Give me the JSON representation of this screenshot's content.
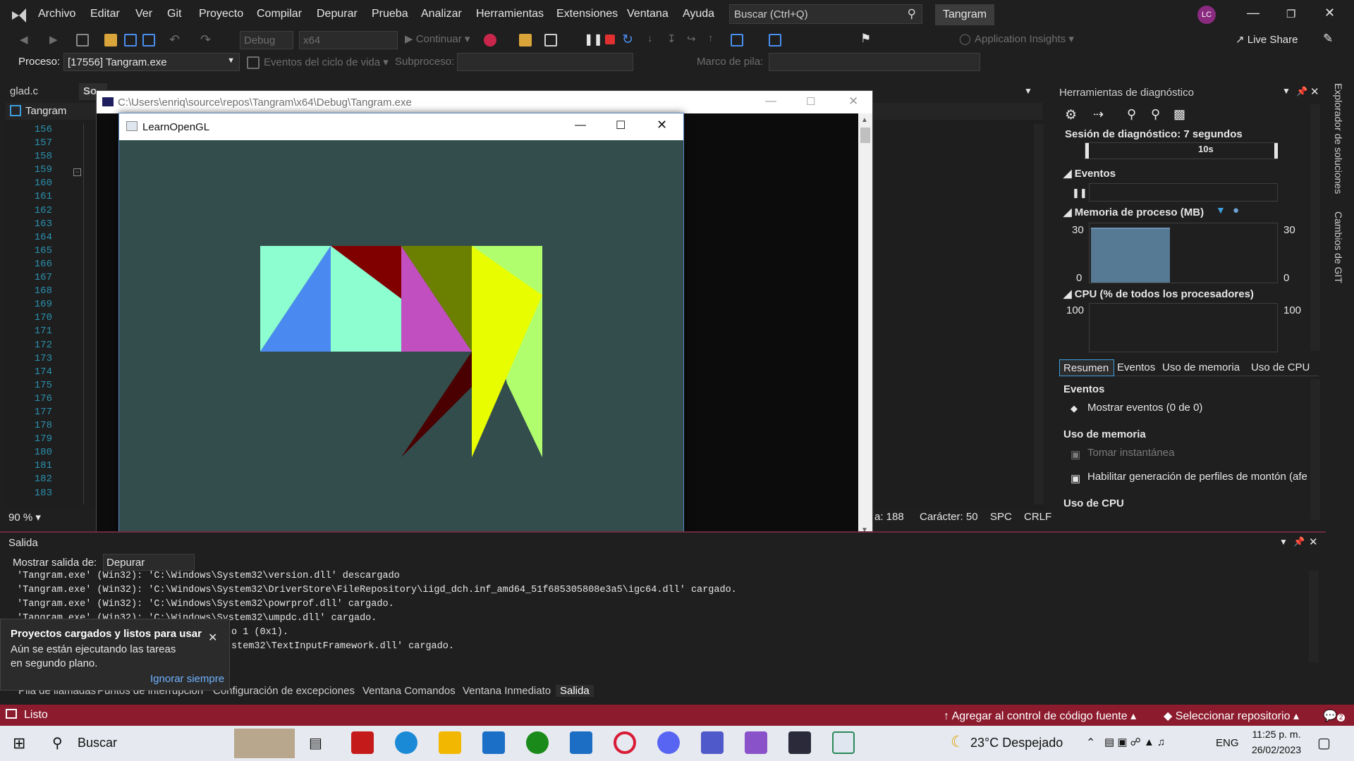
{
  "menu": [
    "Archivo",
    "Editar",
    "Ver",
    "Git",
    "Proyecto",
    "Compilar",
    "Depurar",
    "Prueba",
    "Analizar",
    "Herramientas",
    "Extensiones",
    "Ventana",
    "Ayuda"
  ],
  "search": {
    "placeholder": "Buscar (Ctrl+Q)"
  },
  "solution_name": "Tangram",
  "avatar_initials": "LC",
  "toolbar": {
    "config": "Debug",
    "platform": "x64",
    "continue": "Continuar",
    "app_insights": "Application Insights",
    "live_share": "Live Share"
  },
  "toolbar2": {
    "process_label": "Proceso:",
    "process_value": "[17556] Tangram.exe",
    "lifecycle": "Eventos del ciclo de vida",
    "thread_label": "Subproceso:",
    "stack_label": "Marco de pila:"
  },
  "doc_tabs": [
    "glad.c",
    "So"
  ],
  "nav_project": "Tangram",
  "line_numbers": [
    "156",
    "157",
    "158",
    "159",
    "160",
    "161",
    "162",
    "163",
    "164",
    "165",
    "166",
    "167",
    "168",
    "169",
    "170",
    "171",
    "172",
    "173",
    "174",
    "175",
    "176",
    "177",
    "178",
    "179",
    "180",
    "181",
    "182",
    "183"
  ],
  "editor_status": {
    "zoom": "90 %",
    "line": "a: 188",
    "char": "Carácter: 50",
    "spc": "SPC",
    "crlf": "CRLF"
  },
  "console": {
    "title": "C:\\Users\\enriq\\source\\repos\\Tangram\\x64\\Debug\\Tangram.exe"
  },
  "gl_window": {
    "title": "LearnOpenGL",
    "bg_color": "#334c4c"
  },
  "tangram_colors": {
    "mint": "#8cfecf",
    "blue": "#4a8af0",
    "darkred": "#800000",
    "magenta": "#c14fc0",
    "olive": "#6b7f00",
    "yellow": "#e8fe00",
    "lightgreen": "#b0fe6e",
    "maroon": "#4a0000"
  },
  "diag": {
    "title": "Herramientas de diagnóstico",
    "session": "Sesión de diagnóstico: 7 segundos",
    "time_marker": "10s",
    "events_label": "Eventos",
    "memory_label": "Memoria de proceso (MB)",
    "mem_max": "30",
    "mem_min": "0",
    "mem_usage_fraction": 0.93,
    "cpu_label": "CPU (% de todos los procesadores)",
    "cpu_max": "100",
    "tabs": [
      "Resumen",
      "Eventos",
      "Uso de memoria",
      "Uso de CPU"
    ],
    "sec_events": "Eventos",
    "show_events": "Mostrar eventos (0 de 0)",
    "sec_memory": "Uso de memoria",
    "snapshot": "Tomar instantánea",
    "heap_profiling": "Habilitar generación de perfiles de montón (afe",
    "sec_cpu": "Uso de CPU"
  },
  "side_tabs": [
    "Explorador de soluciones",
    "Cambios de GIT"
  ],
  "output": {
    "title": "Salida",
    "show_label": "Mostrar salida de:",
    "show_value": "Depurar",
    "lines": [
      "'Tangram.exe' (Win32): 'C:\\Windows\\System32\\version.dll' descargado",
      "'Tangram.exe' (Win32): 'C:\\Windows\\System32\\DriverStore\\FileRepository\\iigd_dch.inf_amd64_51f685305808e3a5\\igc64.dll' cargado.",
      "'Tangram.exe' (Win32): 'C:\\Windows\\System32\\powrprof.dll' cargado.",
      "'Tangram.exe' (Win32): 'C:\\Windows\\System32\\umpdc.dll' cargado.",
      "o 1 (0x1).",
      "stem32\\TextInputFramework.dll' cargado."
    ]
  },
  "bottom_tabs": [
    "Pila de llamadas",
    "Puntos de interrupción",
    "Configuración de excepciones",
    "Ventana Comandos",
    "Ventana Inmediato",
    "Salida"
  ],
  "toast": {
    "title": "Proyectos cargados y listos para usar",
    "body": "Aún se están ejecutando las tareas en segundo plano.",
    "link": "Ignorar siempre"
  },
  "statusbar": {
    "ready": "Listo",
    "source_control": "Agregar al control de código fuente",
    "repo": "Seleccionar repositorio",
    "notif_count": "2"
  },
  "taskbar": {
    "search": "Buscar",
    "weather": "23°C  Despejado",
    "lang": "ENG",
    "time": "11:25 p. m.",
    "date": "26/02/2023"
  }
}
